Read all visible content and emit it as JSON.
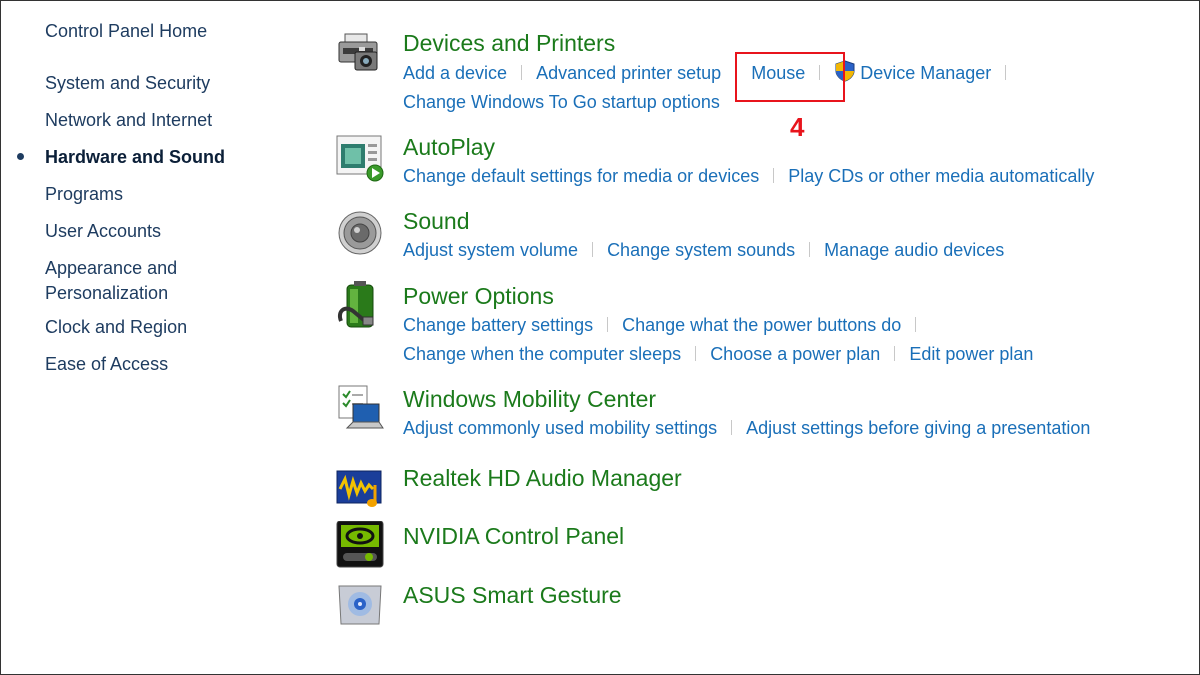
{
  "nav": {
    "home": "Control Panel Home",
    "items": [
      {
        "label": "System and Security"
      },
      {
        "label": "Network and Internet"
      },
      {
        "label": "Hardware and Sound"
      },
      {
        "label": "Programs"
      },
      {
        "label": "User Accounts"
      },
      {
        "label": "Appearance and"
      },
      {
        "label": "Personalization"
      },
      {
        "label": "Clock and Region"
      },
      {
        "label": "Ease of Access"
      }
    ]
  },
  "categories": {
    "devices": {
      "title": "Devices and Printers",
      "icon": "printer-icon",
      "links": [
        "Add a device",
        "Advanced printer setup",
        "Mouse",
        "Device Manager",
        "Change Windows To Go startup options"
      ]
    },
    "autoplay": {
      "title": "AutoPlay",
      "icon": "autoplay-icon",
      "links": [
        "Change default settings for media or devices",
        "Play CDs or other media automatically"
      ]
    },
    "sound": {
      "title": "Sound",
      "icon": "speaker-icon",
      "links": [
        "Adjust system volume",
        "Change system sounds",
        "Manage audio devices"
      ]
    },
    "power": {
      "title": "Power Options",
      "icon": "battery-icon",
      "links": [
        "Change battery settings",
        "Change what the power buttons do",
        "Change when the computer sleeps",
        "Choose a power plan",
        "Edit power plan"
      ]
    },
    "mobility": {
      "title": "Windows Mobility Center",
      "icon": "laptop-icon",
      "links": [
        "Adjust commonly used mobility settings",
        "Adjust settings before giving a presentation"
      ]
    },
    "realtek": {
      "title": "Realtek HD Audio Manager",
      "icon": "realtek-audio-icon"
    },
    "nvidia": {
      "title": "NVIDIA Control Panel",
      "icon": "nvidia-icon"
    },
    "asus": {
      "title": "ASUS Smart Gesture",
      "icon": "touchpad-icon"
    }
  },
  "annotation": {
    "step": "4"
  },
  "colors": {
    "title": "#1b7a1b",
    "link": "#1a6fb8",
    "highlight": "#e8141c"
  }
}
